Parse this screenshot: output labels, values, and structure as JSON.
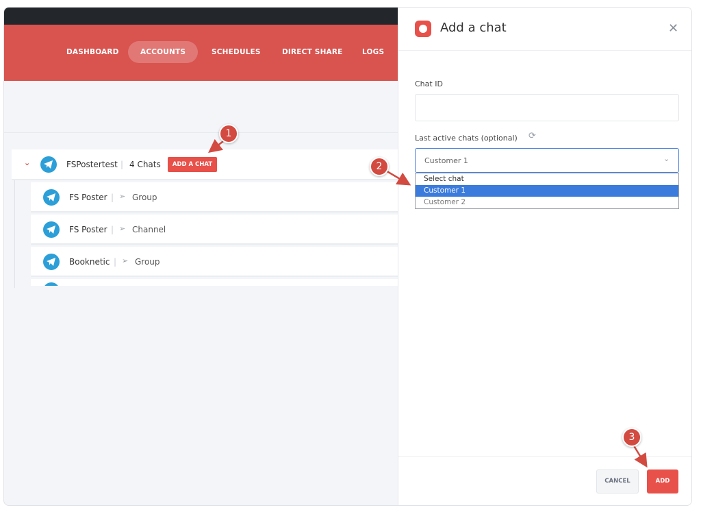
{
  "nav": {
    "items": [
      "DASHBOARD",
      "ACCOUNTS",
      "SCHEDULES",
      "DIRECT SHARE",
      "LOGS"
    ],
    "active": "ACCOUNTS"
  },
  "account": {
    "name": "FSPostertest",
    "chats": "4 Chats",
    "add_chat_label": "ADD A CHAT",
    "children": [
      {
        "name": "FS Poster",
        "type": "Group"
      },
      {
        "name": "FS Poster",
        "type": "Channel"
      },
      {
        "name": "Booknetic",
        "type": "Group"
      }
    ]
  },
  "panel": {
    "title": "Add a chat",
    "chat_id_label": "Chat ID",
    "chat_id_value": "",
    "last_active_label": "Last active chats (optional)",
    "selected": "Customer 1",
    "options": [
      "Select chat",
      "Customer 1",
      "Customer 2"
    ],
    "cancel_label": "CANCEL",
    "add_label": "ADD"
  },
  "annotations": [
    "1",
    "2",
    "3"
  ],
  "colors": {
    "accent": "#d9534f",
    "button_red": "#e8504a",
    "telegram_blue": "#2c9fd8",
    "select_blue": "#3a7bdc"
  }
}
